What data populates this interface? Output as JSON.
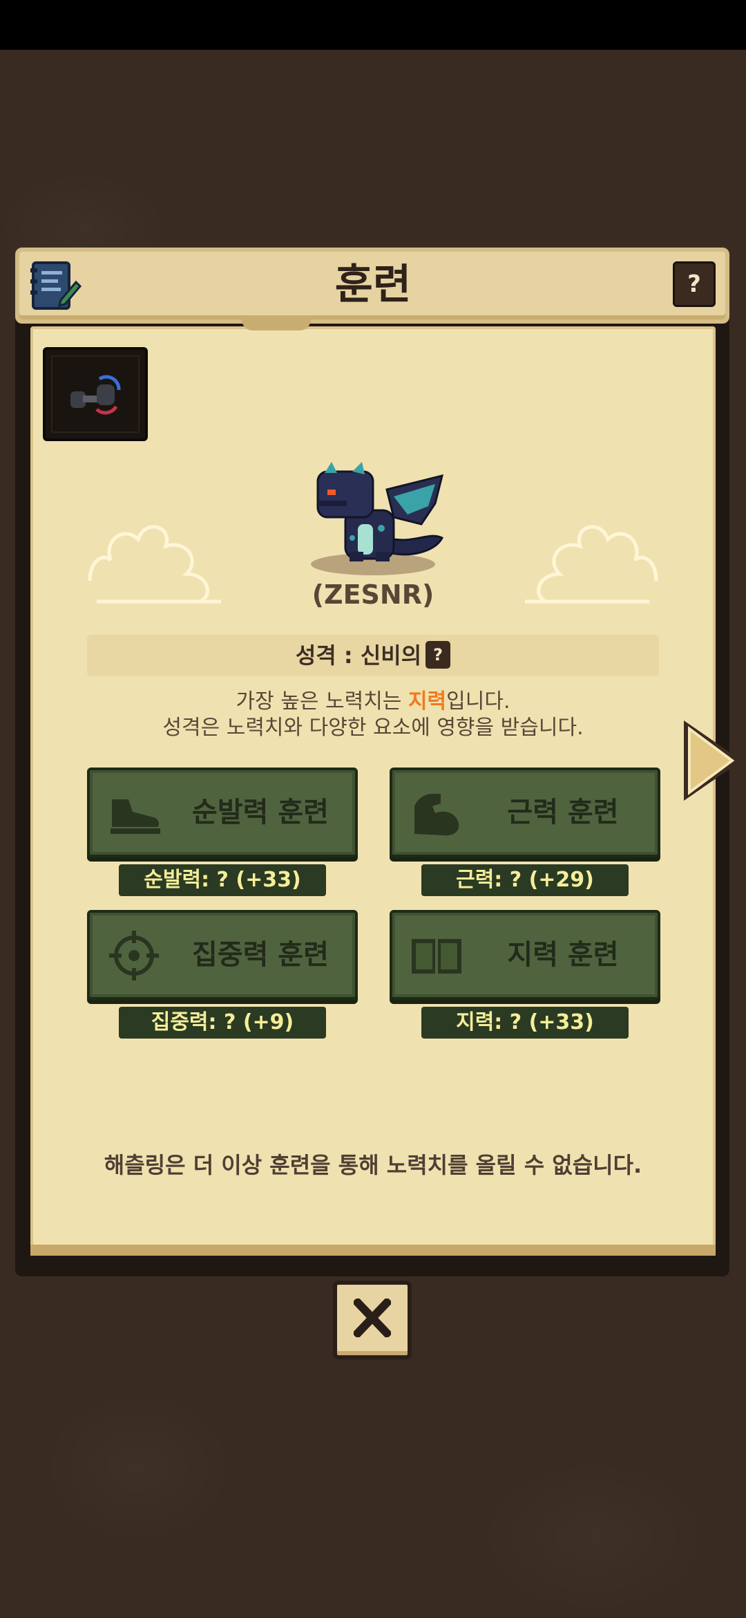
{
  "header": {
    "title": "훈련",
    "help_label": "?"
  },
  "character": {
    "name": "(ZESNR)"
  },
  "personality": {
    "label": "성격 : 신비의",
    "help_label": "?"
  },
  "description": {
    "line1_before": "가장 높은 노력치는 ",
    "line1_highlight": "지력",
    "line1_after": "입니다.",
    "line2": "성격은 노력치와 다양한 요소에 영향을 받습니다.",
    "highlight_color": "#f07a1e"
  },
  "trainings": [
    {
      "label": "순발력 훈련",
      "stat": "순발력: ? (+33)",
      "icon": "shoe-icon"
    },
    {
      "label": "근력 훈련",
      "stat": "근력: ? (+29)",
      "icon": "muscle-arm-icon"
    },
    {
      "label": "집중력 훈련",
      "stat": "집중력: ? (+9)",
      "icon": "crosshair-icon"
    },
    {
      "label": "지력 훈련",
      "stat": "지력: ? (+33)",
      "icon": "book-icon"
    }
  ],
  "note": "해츨링은 더 이상 훈련을 통해 노력치를 올릴 수 없습니다.",
  "colors": {
    "panel": "#f0e2b0",
    "button_green": "#50633f",
    "stat_text": "#f4ee9a",
    "background": "#3a2b22"
  }
}
